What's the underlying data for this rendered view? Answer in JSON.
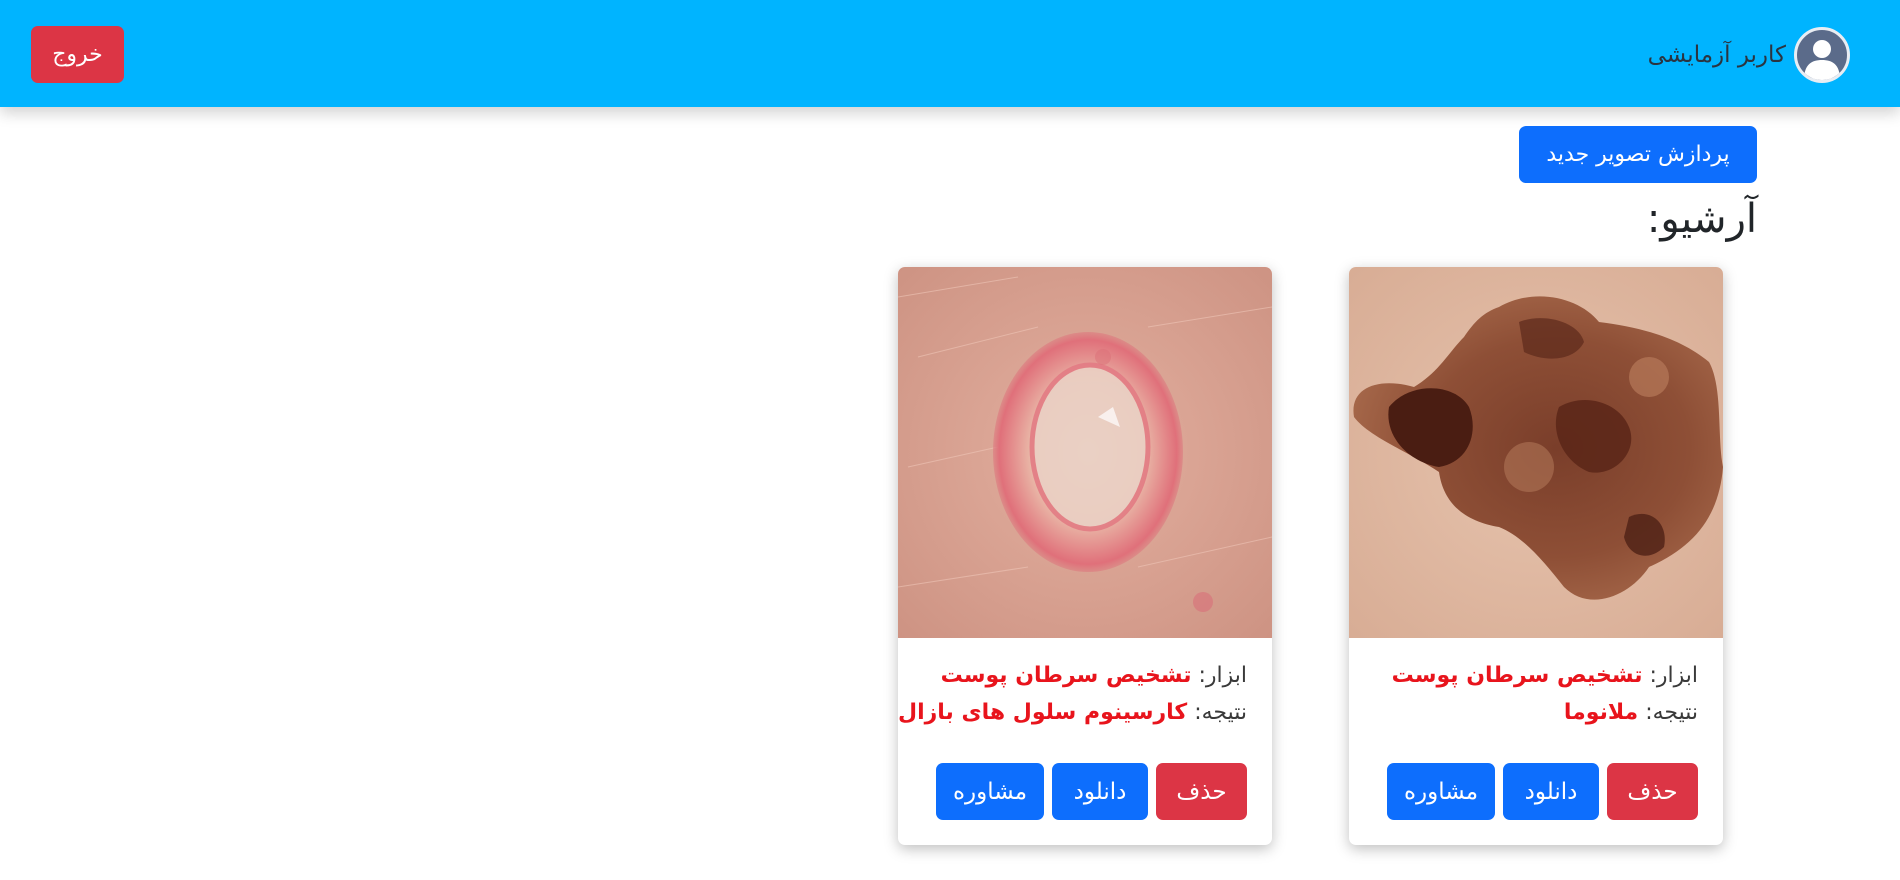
{
  "navbar": {
    "username": "کاربر آزمایشی",
    "logout_label": "خروج",
    "avatar_icon": "user-avatar-icon",
    "color": "#00b4ff"
  },
  "main": {
    "new_image_button": "پردازش تصویر جدید",
    "archive_title": "آرشیو:"
  },
  "cards": [
    {
      "image": "melanoma-skin-lesion-photo",
      "tool_label": "ابزار:",
      "tool_value": "تشخیص سرطان پوست",
      "result_label": "نتیجه:",
      "result_value": "ملانوما",
      "delete_label": "حذف",
      "download_label": "دانلود",
      "consult_label": "مشاوره"
    },
    {
      "image": "basal-cell-carcinoma-skin-photo",
      "tool_label": "ابزار:",
      "tool_value": "تشخیص سرطان پوست",
      "result_label": "نتیجه:",
      "result_value": "کارسینوم سلول های بازال",
      "delete_label": "حذف",
      "download_label": "دانلود",
      "consult_label": "مشاوره"
    }
  ],
  "colors": {
    "danger": "#dc3545",
    "primary": "#0d6efd",
    "result_text": "#e8141c"
  }
}
